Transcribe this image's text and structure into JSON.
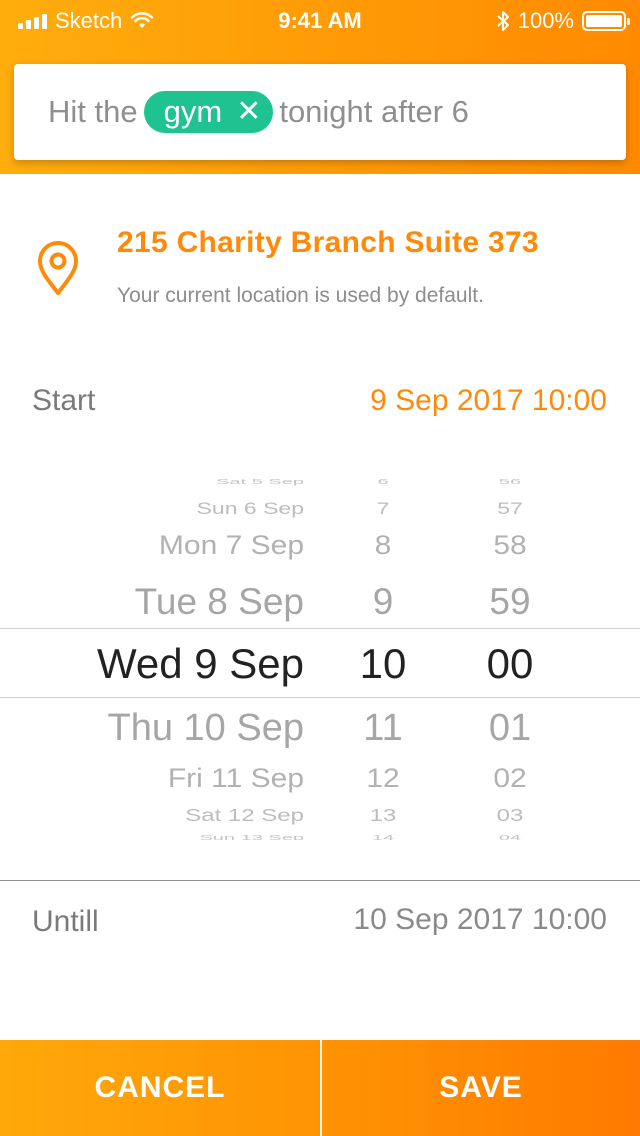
{
  "status_bar": {
    "carrier": "Sketch",
    "time": "9:41 AM",
    "battery": "100%"
  },
  "composer": {
    "text_before": "Hit the",
    "tag": "gym",
    "text_after": "tonight after 6"
  },
  "location": {
    "address": "215 Charity Branch Suite 373",
    "note": "Your current location is used by default."
  },
  "start": {
    "label": "Start",
    "value": "9 Sep 2017 10:00"
  },
  "picker": {
    "days": [
      "Sat 5 Sep",
      "Sun 6 Sep",
      "Mon 7 Sep",
      "Tue 8 Sep",
      "Wed 9 Sep",
      "Thu 10 Sep",
      "Fri 11 Sep",
      "Sat 12 Sep",
      "Sun 13 Sep"
    ],
    "hours": [
      "6",
      "7",
      "8",
      "9",
      "10",
      "11",
      "12",
      "13",
      "14"
    ],
    "minutes": [
      "56",
      "57",
      "58",
      "59",
      "00",
      "01",
      "02",
      "03",
      "04"
    ],
    "selected_index": 4
  },
  "until": {
    "label": "Untill",
    "value": "10 Sep 2017 10:00"
  },
  "actions": {
    "cancel": "CANCEL",
    "save": "SAVE"
  },
  "colors": {
    "accent": "#ff8a0a",
    "tag": "#1fc38f"
  }
}
